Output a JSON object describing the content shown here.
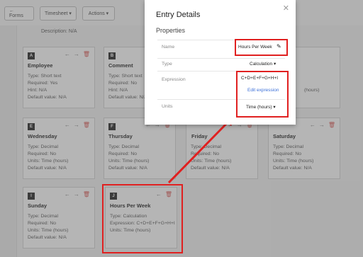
{
  "toolbar": {
    "forms_label": "← Forms",
    "timesheet_label": "Timesheet ▾",
    "actions_label": "Actions ▾"
  },
  "description": "Description: N/A",
  "cards": {
    "a": {
      "letter": "A",
      "title": "Employee",
      "lines": [
        "Type: Short text",
        "Required: Yes",
        "Hint: N/A",
        "Default value: N/A"
      ]
    },
    "b": {
      "letter": "B",
      "title": "Comment",
      "lines": [
        "Type: Short text",
        "Required: No",
        "Hint: N/A",
        "Default value: N/A"
      ]
    },
    "c_line": "(hours)",
    "e": {
      "letter": "E",
      "title": "Wednesday",
      "lines": [
        "Type: Decimal",
        "Required: No",
        "Units: Time (hours)",
        "Default value: N/A"
      ]
    },
    "f": {
      "letter": "F",
      "title": "Thursday",
      "lines": [
        "Type: Decimal",
        "Required: No",
        "Units: Time (hours)",
        "Default value: N/A"
      ]
    },
    "g": {
      "title": "Friday",
      "lines": [
        "Type: Decimal",
        "Required: No",
        "Units: Time (hours)",
        "Default value: N/A"
      ]
    },
    "h": {
      "title": "Saturday",
      "lines": [
        "Type: Decimal",
        "Required: No",
        "Units: Time (hours)",
        "Default value: N/A"
      ]
    },
    "i": {
      "letter": "I",
      "title": "Sunday",
      "lines": [
        "Type: Decimal",
        "Required: No",
        "Units: Time (hours)",
        "Default value: N/A"
      ]
    },
    "j": {
      "letter": "J",
      "title": "Hours Per Week",
      "lines": [
        "Type: Calculation",
        "Expression: C+D+E+F+G+H+I",
        "Units: Time (hours)"
      ]
    }
  },
  "modal": {
    "title": "Entry Details",
    "subtitle": "Properties",
    "name_label": "Name",
    "name_value": "Hours Per Week",
    "type_label": "Type",
    "type_value": "Calculation ▾",
    "expression_label": "Expression",
    "expression_value": "C+D+E+F+G+H+I",
    "edit_expression": "Edit expression",
    "units_label": "Units",
    "units_value": "Time (hours) ▾"
  },
  "colors": {
    "highlight": "#e02020",
    "link": "#3b6fd8",
    "delete": "#d9534f"
  }
}
